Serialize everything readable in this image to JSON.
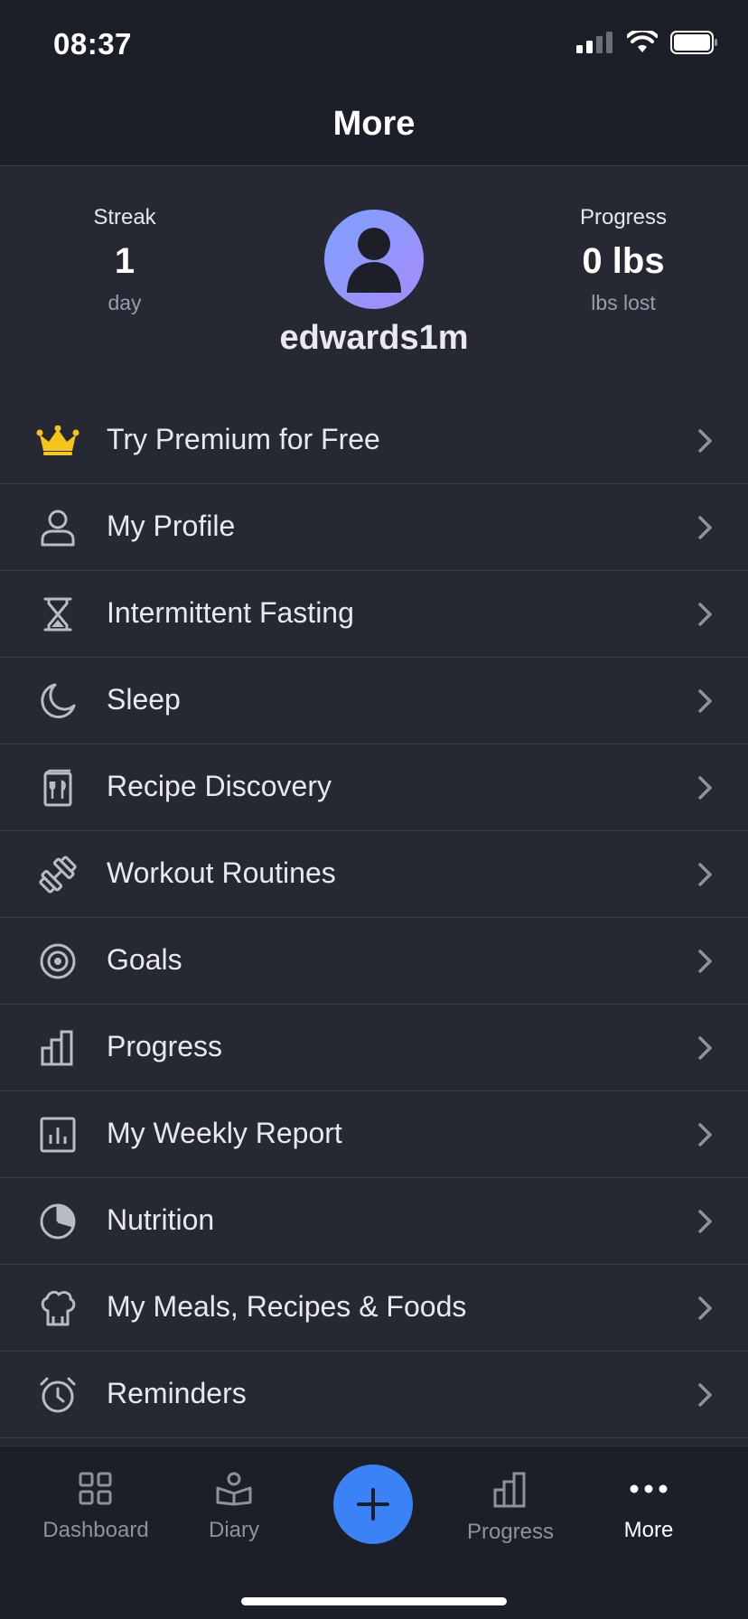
{
  "status_bar": {
    "time": "08:37"
  },
  "header": {
    "title": "More"
  },
  "summary": {
    "streak": {
      "label": "Streak",
      "value": "1",
      "unit": "day"
    },
    "progress": {
      "label": "Progress",
      "value": "0 lbs",
      "unit": "lbs lost"
    },
    "username": "edwards1m"
  },
  "menu": {
    "items": [
      {
        "label": "Try Premium for Free",
        "icon": "crown-icon"
      },
      {
        "label": "My Profile",
        "icon": "person-icon"
      },
      {
        "label": "Intermittent Fasting",
        "icon": "hourglass-icon"
      },
      {
        "label": "Sleep",
        "icon": "moon-icon"
      },
      {
        "label": "Recipe Discovery",
        "icon": "recipe-book-icon"
      },
      {
        "label": "Workout Routines",
        "icon": "dumbbell-icon"
      },
      {
        "label": "Goals",
        "icon": "target-icon"
      },
      {
        "label": "Progress",
        "icon": "bar-chart-icon"
      },
      {
        "label": "My Weekly Report",
        "icon": "report-icon"
      },
      {
        "label": "Nutrition",
        "icon": "pie-chart-icon"
      },
      {
        "label": "My Meals, Recipes & Foods",
        "icon": "chef-hat-icon"
      },
      {
        "label": "Reminders",
        "icon": "alarm-clock-icon"
      }
    ]
  },
  "tabbar": {
    "dashboard": "Dashboard",
    "diary": "Diary",
    "progress": "Progress",
    "more": "More",
    "active": "More"
  },
  "colors": {
    "accent": "#3b82f6",
    "premium_gold": "#f5c518",
    "background": "#262834",
    "header_background": "#1c1e28"
  }
}
